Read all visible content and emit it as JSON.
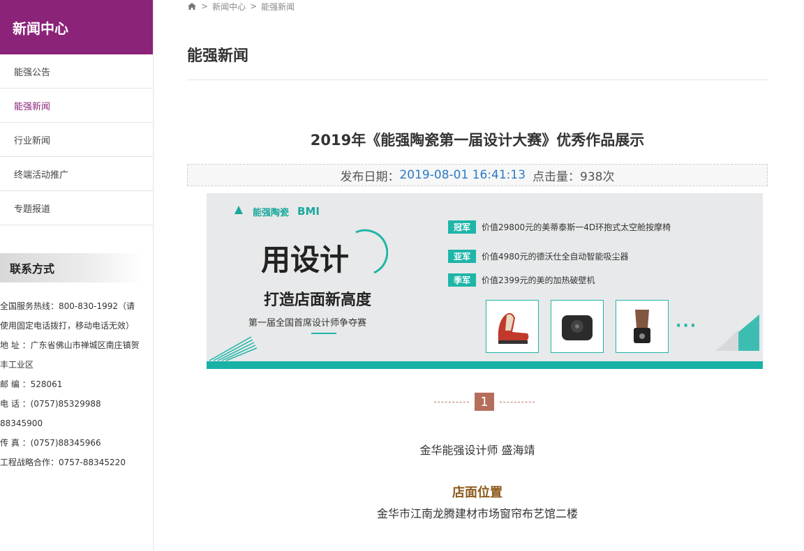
{
  "sidebar": {
    "title": "新闻中心",
    "items": [
      {
        "label": "能强公告"
      },
      {
        "label": "能强新闻"
      },
      {
        "label": "行业新闻"
      },
      {
        "label": "终端活动推广"
      },
      {
        "label": "专题报道"
      }
    ],
    "active_index": 1,
    "contact": {
      "title": "联系方式",
      "lines": [
        "全国服务热线：800-830-1992（请",
        "使用固定电话拨打，移动电话无效）",
        "地 址 ：广东省佛山市禅城区南庄镇贺",
        "丰工业区",
        "邮 编 ：528061",
        "电 话 ：(0757)85329988 88345900",
        "传 真 ：(0757)88345966",
        "工程战略合作：0757-88345220"
      ]
    }
  },
  "breadcrumb": {
    "sep1": ">",
    "item1": "新闻中心",
    "sep2": ">",
    "item2": "能强新闻"
  },
  "main": {
    "page_title": "能强新闻",
    "article_title": "2019年《能强陶瓷第一届设计大赛》优秀作品展示",
    "meta": {
      "date_label": "发布日期：",
      "date": "2019-08-01 16:41:13",
      "hits_label": "点击量：",
      "hits": "938次"
    },
    "banner": {
      "brand": "能强陶瓷",
      "bmi": "BMI",
      "big_1": "用",
      "big_2": "设计",
      "slogan": "打造店面新高度",
      "sub": "第一届全国首席设计师争夺赛",
      "prizes": [
        {
          "tag": "冠军",
          "text": "价值29800元的美蒂泰斯一4D环抱式太空舱按摩椅"
        },
        {
          "tag": "亚军",
          "text": "价值4980元的德沃仕全自动智能吸尘器"
        },
        {
          "tag": "季军",
          "text": "价值2399元的美的加热破壁机"
        }
      ],
      "dots": "···",
      "accent": "#1fb5a8"
    },
    "page_number": "1",
    "designer": "金华能强设计师  盛海靖",
    "location_heading": "店面位置",
    "location_text": "金华市江南龙腾建材市场窗帘布艺馆二楼"
  },
  "colors": {
    "brand_purple": "#8b2479",
    "date_blue": "#2a7ac7",
    "heading_brown": "#8b5a1c"
  }
}
